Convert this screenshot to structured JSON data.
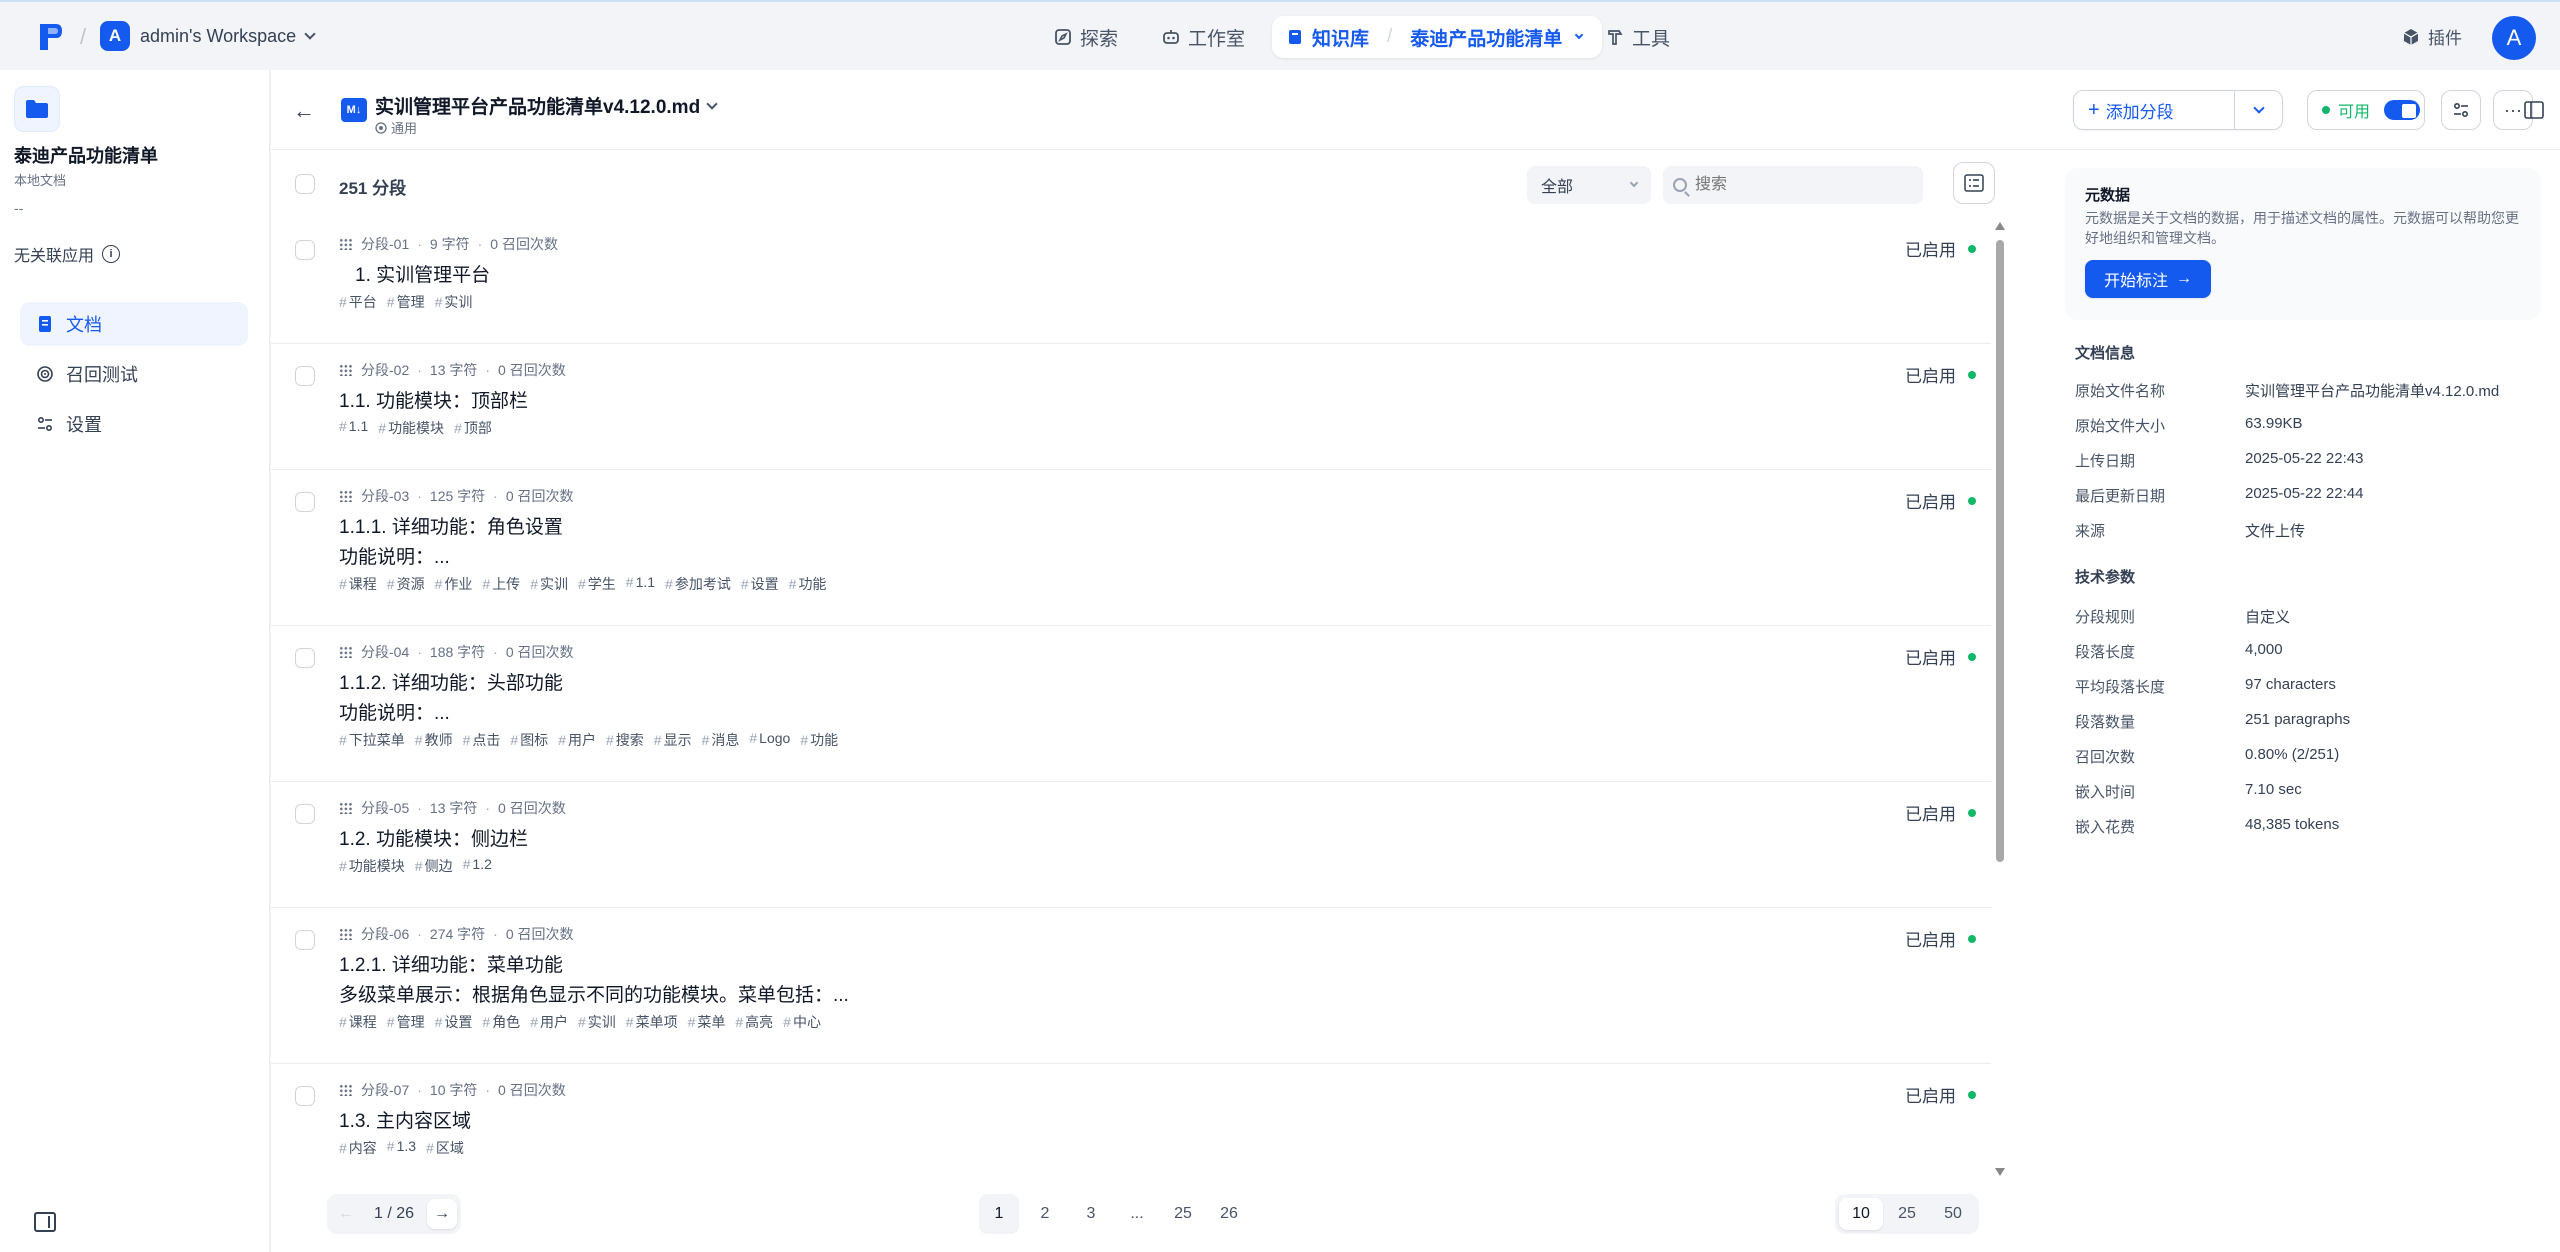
{
  "topbar": {
    "workspace_initial": "A",
    "workspace_name": "admin's Workspace",
    "nav_explore": "探索",
    "nav_studio": "工作室",
    "nav_kb": "知识库",
    "nav_kb_current": "泰迪产品功能清单",
    "nav_tools": "工具",
    "plugins": "插件",
    "user_initial": "A"
  },
  "sidebar": {
    "title": "泰迪产品功能清单",
    "subtitle": "本地文档",
    "dash": "--",
    "related": "无关联应用",
    "items": [
      {
        "label": "文档",
        "icon": "document-icon",
        "active": true
      },
      {
        "label": "召回测试",
        "icon": "target-icon",
        "active": false
      },
      {
        "label": "设置",
        "icon": "settings-icon",
        "active": false
      }
    ]
  },
  "doc": {
    "badge": "M↓",
    "name": "实训管理平台产品功能清单v4.12.0.md",
    "mode": "通用",
    "add_segment": "添加分段",
    "status": "可用"
  },
  "list": {
    "count": "251 分段",
    "filter": "全部",
    "search_placeholder": "搜索",
    "enabled_label": "已启用",
    "segments": [
      {
        "id": "分段-01",
        "chars": "9 字符",
        "recall": "0 召回次数",
        "title": "1. 实训管理平台",
        "desc": "",
        "tags": [
          "平台",
          "管理",
          "实训"
        ]
      },
      {
        "id": "分段-02",
        "chars": "13 字符",
        "recall": "0 召回次数",
        "title": "1.1. 功能模块：顶部栏",
        "desc": "",
        "tags": [
          "1.1",
          "功能模块",
          "顶部"
        ]
      },
      {
        "id": "分段-03",
        "chars": "125 字符",
        "recall": "0 召回次数",
        "title": "1.1.1. 详细功能：角色设置",
        "desc": "功能说明：...",
        "tags": [
          "课程",
          "资源",
          "作业",
          "上传",
          "实训",
          "学生",
          "1.1",
          "参加考试",
          "设置",
          "功能"
        ]
      },
      {
        "id": "分段-04",
        "chars": "188 字符",
        "recall": "0 召回次数",
        "title": "1.1.2. 详细功能：头部功能",
        "desc": "功能说明：...",
        "tags": [
          "下拉菜单",
          "教师",
          "点击",
          "图标",
          "用户",
          "搜索",
          "显示",
          "消息",
          "Logo",
          "功能"
        ]
      },
      {
        "id": "分段-05",
        "chars": "13 字符",
        "recall": "0 召回次数",
        "title": "1.2. 功能模块：侧边栏",
        "desc": "",
        "tags": [
          "功能模块",
          "侧边",
          "1.2"
        ]
      },
      {
        "id": "分段-06",
        "chars": "274 字符",
        "recall": "0 召回次数",
        "title": "1.2.1. 详细功能：菜单功能",
        "desc": "多级菜单展示：根据角色显示不同的功能模块。菜单包括：...",
        "tags": [
          "课程",
          "管理",
          "设置",
          "角色",
          "用户",
          "实训",
          "菜单项",
          "菜单",
          "高亮",
          "中心"
        ]
      },
      {
        "id": "分段-07",
        "chars": "10 字符",
        "recall": "0 召回次数",
        "title": "1.3. 主内容区域",
        "desc": "",
        "tags": [
          "内容",
          "1.3",
          "区域"
        ]
      }
    ]
  },
  "pager": {
    "current": "1",
    "total": "26",
    "pages": [
      "1",
      "2",
      "3",
      "...",
      "25",
      "26"
    ],
    "sizes": [
      "10",
      "25",
      "50"
    ]
  },
  "meta": {
    "title": "元数据",
    "desc": "元数据是关于文档的数据，用于描述文档的属性。元数据可以帮助您更好地组织和管理文档。",
    "button": "开始标注"
  },
  "doc_info": {
    "heading": "文档信息",
    "rows": [
      {
        "k": "原始文件名称",
        "v": "实训管理平台产品功能清单v4.12.0.md"
      },
      {
        "k": "原始文件大小",
        "v": "63.99KB"
      },
      {
        "k": "上传日期",
        "v": "2025-05-22 22:43"
      },
      {
        "k": "最后更新日期",
        "v": "2025-05-22 22:44"
      },
      {
        "k": "来源",
        "v": "文件上传"
      }
    ]
  },
  "tech": {
    "heading": "技术参数",
    "rows": [
      {
        "k": "分段规则",
        "v": "自定义"
      },
      {
        "k": "段落长度",
        "v": "4,000"
      },
      {
        "k": "平均段落长度",
        "v": "97 characters"
      },
      {
        "k": "段落数量",
        "v": "251 paragraphs"
      },
      {
        "k": "召回次数",
        "v": "0.80% (2/251)"
      },
      {
        "k": "嵌入时间",
        "v": "7.10 sec"
      },
      {
        "k": "嵌入花费",
        "v": "48,385 tokens"
      }
    ]
  },
  "colors": {
    "accent": "#155aef",
    "enabled": "#12b76a"
  }
}
